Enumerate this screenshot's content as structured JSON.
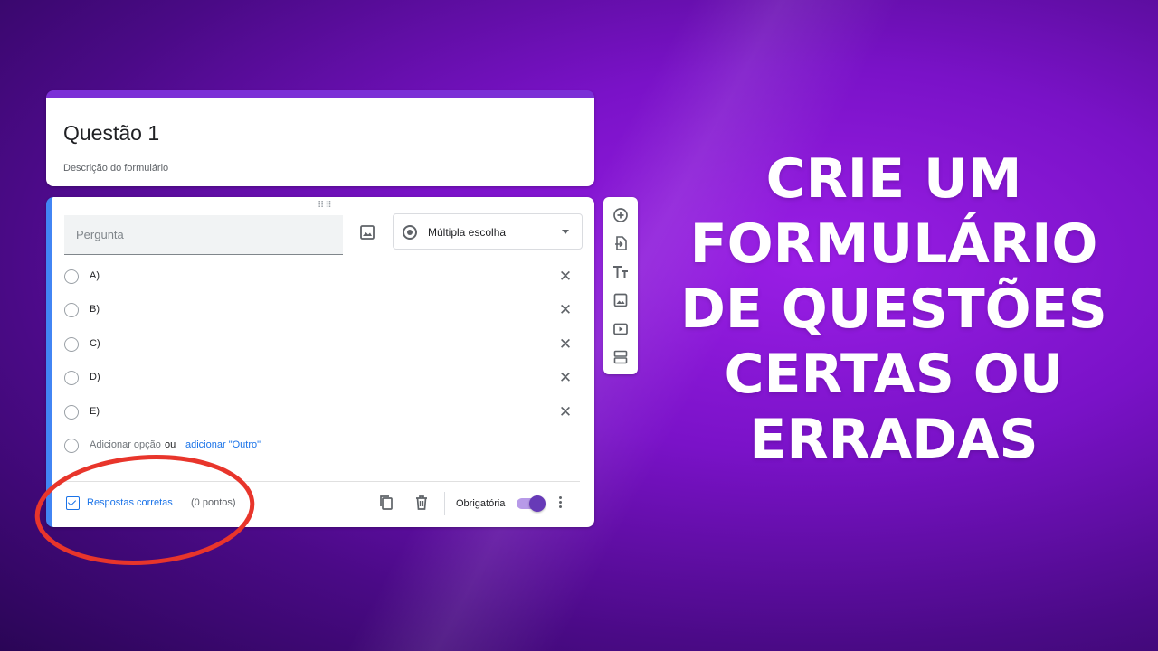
{
  "form": {
    "title": "Questão 1",
    "description": "Descrição do formulário"
  },
  "question": {
    "placeholder": "Pergunta",
    "type_label": "Múltipla escolha",
    "options": [
      "A)",
      "B)",
      "C)",
      "D)",
      "E)"
    ],
    "add_option_label": "Adicionar opção",
    "or_label": "ou",
    "add_other_label": "adicionar \"Outro\"",
    "answers_label": "Respostas corretas",
    "points_label": "(0 pontos)",
    "required_label": "Obrigatória",
    "required_on": true
  },
  "toolbar": {
    "icons": [
      "add-question-icon",
      "import-questions-icon",
      "add-title-icon",
      "add-image-icon",
      "add-video-icon",
      "add-section-icon"
    ]
  },
  "headline": {
    "lines": [
      "CRIE UM",
      "FORMULÁRIO",
      "DE QUESTÕES",
      "CERTAS OU",
      "ERRADAS"
    ]
  },
  "colors": {
    "accent": "#7b2fd6",
    "link": "#1a73e8",
    "toggle": "#673ab7",
    "highlight": "#e8352b"
  }
}
